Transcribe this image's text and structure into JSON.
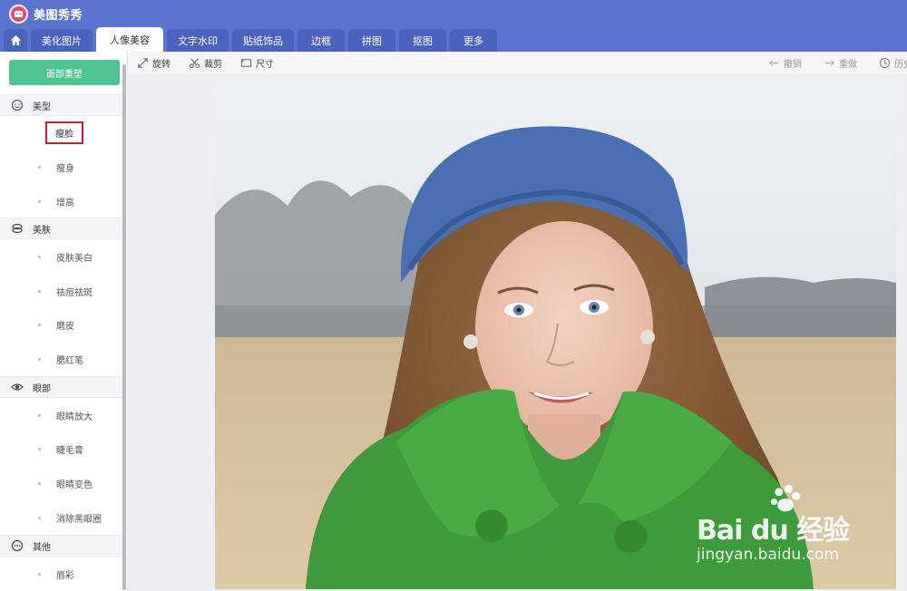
{
  "app": {
    "title": "美图秀秀"
  },
  "tabs": [
    {
      "label": "美化图片"
    },
    {
      "label": "人像美容",
      "active": true
    },
    {
      "label": "文字水印"
    },
    {
      "label": "贴纸饰品"
    },
    {
      "label": "边框"
    },
    {
      "label": "拼图"
    },
    {
      "label": "抠图"
    },
    {
      "label": "更多"
    }
  ],
  "sidebar": {
    "reshape_button": "面部重塑",
    "sections": {
      "shape": {
        "title": "美型",
        "items": [
          "瘦脸",
          "瘦身",
          "增高"
        ]
      },
      "skin": {
        "title": "美肤",
        "items": [
          "皮肤美白",
          "祛痘祛斑",
          "磨皮",
          "腮红笔"
        ]
      },
      "eyes": {
        "title": "眼部",
        "items": [
          "眼睛放大",
          "睫毛膏",
          "眼睛变色",
          "消除黑眼圈"
        ]
      },
      "other": {
        "title": "其他",
        "items": [
          "唇彩"
        ]
      }
    },
    "selected_item": "瘦脸"
  },
  "toolbar": {
    "rotate": "旋转",
    "crop": "裁剪",
    "size": "尺寸",
    "undo": "撤销",
    "redo": "重做",
    "history": "历史"
  },
  "watermark": {
    "brand": "Bai du 经验",
    "url": "jingyan.baidu.com"
  },
  "colors": {
    "header_blue": "#5b74cf",
    "accent_green": "#4fc491",
    "highlight_red": "#c8202a"
  }
}
